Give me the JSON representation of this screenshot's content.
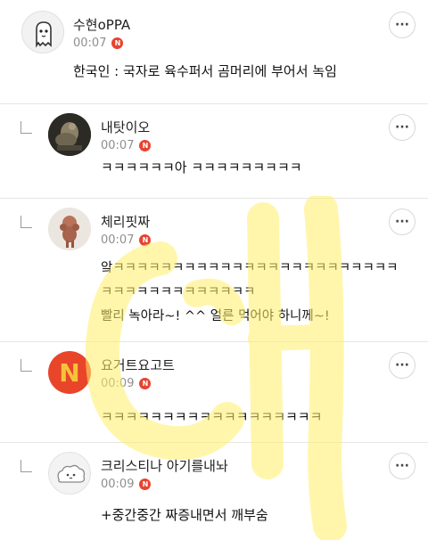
{
  "comments": [
    {
      "author": "수현oPPA",
      "time": "00:07",
      "badge": "N",
      "lines": [
        "한국인 : 국자로 육수퍼서 곰머리에 부어서 녹임"
      ],
      "avatar_icon": "ghost-mascot-icon"
    },
    {
      "author": "내탓이오",
      "time": "00:07",
      "badge": "N",
      "lines": [
        "ㅋㅋㅋㅋㅋㅋ아 ㅋㅋㅋㅋㅋㅋㅋㅋㅋ"
      ],
      "avatar_icon": "sculpture-photo-icon"
    },
    {
      "author": "체리핏짜",
      "time": "00:07",
      "badge": "N",
      "lines": [
        "앜ㅋㅋㅋㅋㅋㅋㅋㅋㅋㅋㅋㅋㅋㅋㅋㅋㅋㅋㅋㅋㅋㅋㅋㅋ",
        "ㅋㅋㅋㅋㅋㅋㅋㅋㅋㅋㅋㅋㅋ",
        "빨리 녹아라~! ^^ 얼른 먹어야 하니께~!"
      ],
      "avatar_icon": "poodle-photo-icon"
    },
    {
      "author": "요거트요고트",
      "time": "00:09",
      "badge": "N",
      "lines": [
        "ㅋㅋㅋㅋㅋㅋㅋㅋㅋㅋㅋㅋㅋㅋㅋㅋㅋㅋ"
      ],
      "avatar_icon": "letter-n-logo-icon",
      "avatar_letter": "N"
    },
    {
      "author": "크리스티나 아기를내놔",
      "time": "00:09",
      "badge": "N",
      "lines": [
        "+중간중간 짜증내면서 깨부숨"
      ],
      "avatar_icon": "cloud-creature-icon"
    }
  ],
  "more_label": "···",
  "colors": {
    "badge": "#e8432f",
    "watermark": "#fff06a",
    "meta_text": "#8f8f8f",
    "divider": "#e6e6e6"
  }
}
